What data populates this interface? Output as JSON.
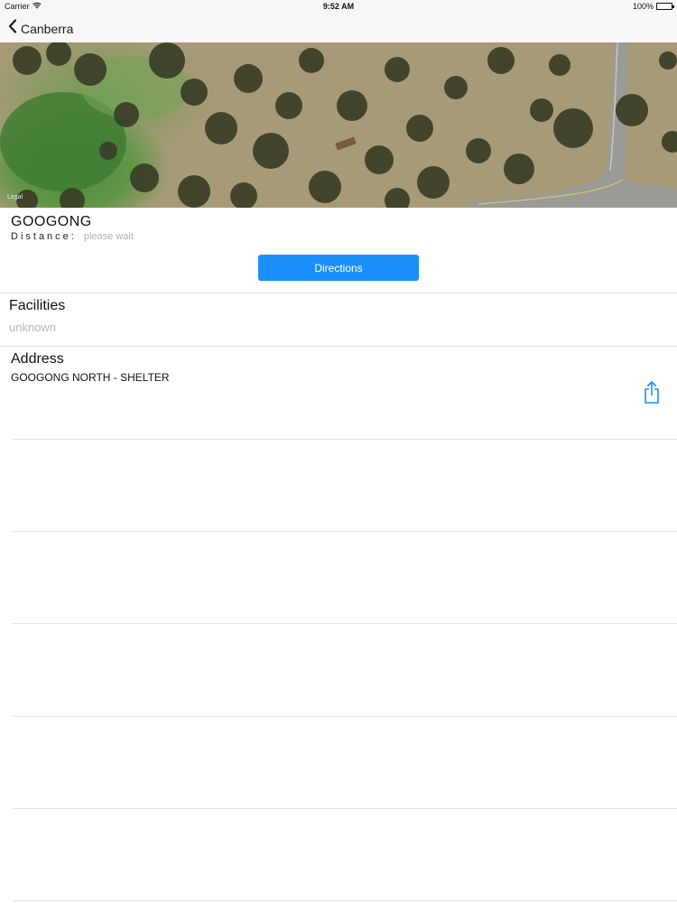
{
  "status_bar": {
    "carrier": "Carrier",
    "time": "9:52 AM",
    "battery_percent": "100%",
    "battery_level": 1.0
  },
  "nav_bar": {
    "back_label": "Canberra",
    "back_icon": "chevron-left-icon"
  },
  "map": {
    "legal_label": "Legal"
  },
  "place": {
    "title": "GOOGONG",
    "distance_label": "Distance:",
    "distance_value": "please wait"
  },
  "actions": {
    "directions_label": "Directions",
    "share_icon": "share-icon"
  },
  "facilities": {
    "heading": "Facilities",
    "value": "unknown"
  },
  "address": {
    "heading": "Address",
    "value": "GOOGONG NORTH - SHELTER"
  },
  "colors": {
    "accent": "#1a8ffb",
    "placeholder_text": "#b5b5b5",
    "separator": "#e2e2e2"
  }
}
